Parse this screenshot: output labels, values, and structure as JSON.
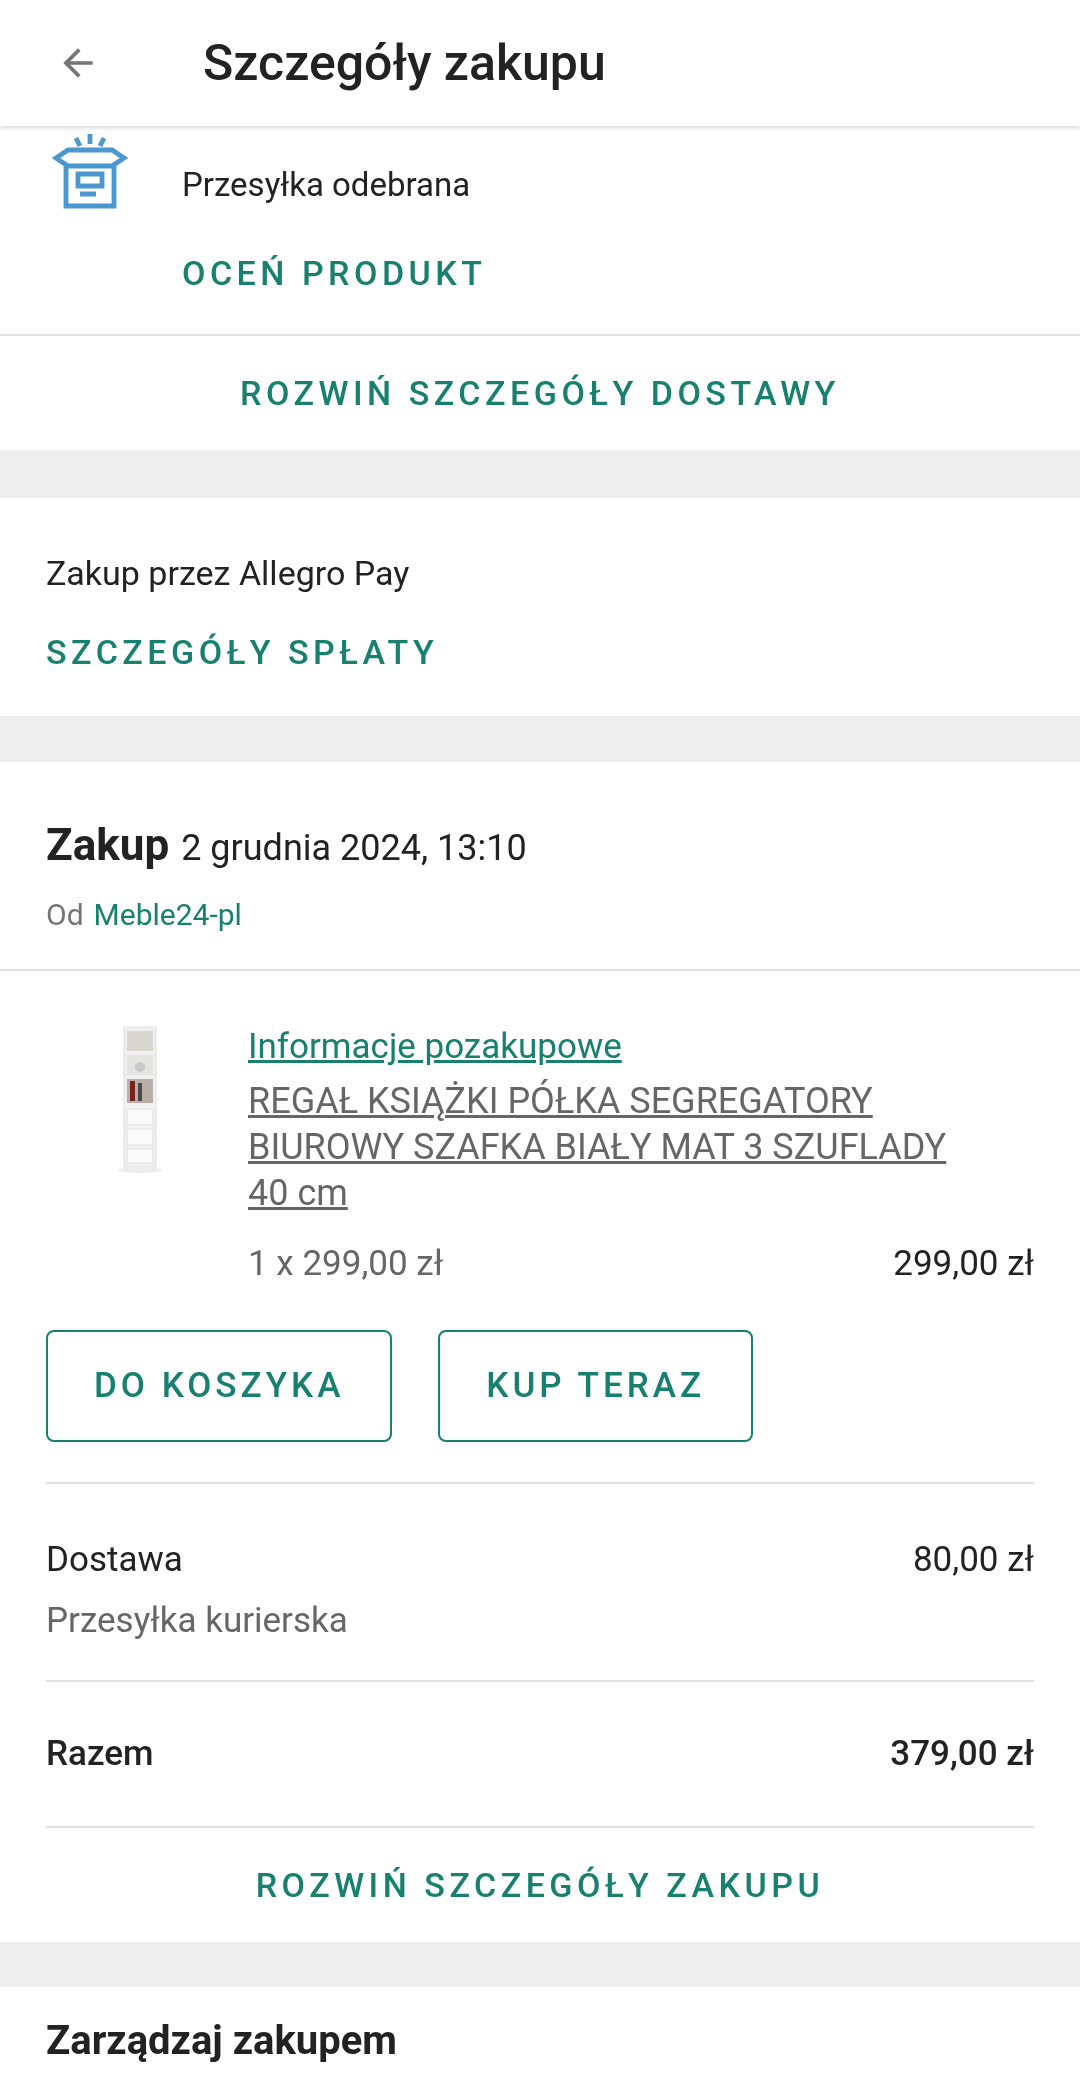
{
  "header": {
    "title": "Szczegóły zakupu"
  },
  "delivery_status": {
    "status": "Przesyłka odebrana",
    "rate_link": "OCEŃ PRODUKT",
    "expand_link": "ROZWIŃ SZCZEGÓŁY DOSTAWY"
  },
  "payment": {
    "text": "Zakup przez Allegro Pay",
    "link": "SZCZEGÓŁY SPŁATY"
  },
  "purchase": {
    "label": "Zakup",
    "date": "2 grudnia 2024, 13:10",
    "seller_prefix": "Od",
    "seller": "Meble24-pl",
    "item": {
      "info_link": "Informacje pozakupowe",
      "name": "REGAŁ KSIĄŻKI PÓŁKA SEGREGATORY BIUROWY SZAFKA BIAŁY MAT 3 SZUFLADY 40 cm",
      "quantity_price": "1 x 299,00 zł",
      "total": "299,00 zł"
    },
    "buttons": [
      "DO KOSZYKA",
      "KUP TERAZ"
    ],
    "delivery": {
      "label": "Dostawa",
      "method": "Przesyłka kurierska",
      "price": "80,00 zł"
    },
    "sum": {
      "label": "Razem",
      "value": "379,00 zł"
    },
    "expand_link": "ROZWIŃ SZCZEGÓŁY ZAKUPU"
  },
  "manage": {
    "title": "Zarządzaj zakupem"
  }
}
